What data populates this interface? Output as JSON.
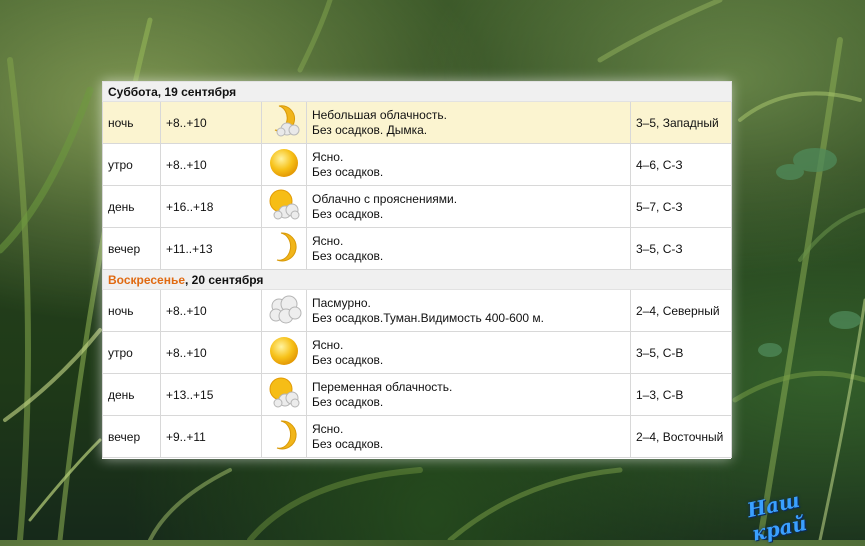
{
  "days": [
    {
      "weekday": "Суббота",
      "date_rest": ", 19 сентября",
      "weekday_color": "#111111",
      "rows": [
        {
          "period": "ночь",
          "temp": "+8..+10",
          "icon": "moon-cloud-icon",
          "line1": "Небольшая облачность.",
          "line2": "Без осадков. Дымка.",
          "wind": "3–5, Западный"
        },
        {
          "period": "утро",
          "temp": "+8..+10",
          "icon": "sun-icon",
          "line1": "Ясно.",
          "line2": "Без осадков.",
          "wind": "4–6, С-З"
        },
        {
          "period": "день",
          "temp": "+16..+18",
          "icon": "sun-cloud-icon",
          "line1": "Облачно с прояснениями.",
          "line2": "Без осадков.",
          "wind": "5–7, С-З"
        },
        {
          "period": "вечер",
          "temp": "+11..+13",
          "icon": "moon-icon",
          "line1": "Ясно.",
          "line2": "Без осадков.",
          "wind": "3–5, С-З"
        }
      ]
    },
    {
      "weekday": "Воскресенье",
      "date_rest": ", 20 сентября",
      "weekday_color": "#e06a12",
      "rows": [
        {
          "period": "ночь",
          "temp": "+8..+10",
          "icon": "cloud-icon",
          "line1": "Пасмурно.",
          "line2": "Без осадков.Туман.Видимость 400-600 м.",
          "wind": "2–4, Северный"
        },
        {
          "period": "утро",
          "temp": "+8..+10",
          "icon": "sun-icon",
          "line1": "Ясно.",
          "line2": "Без осадков.",
          "wind": "3–5, С-В"
        },
        {
          "period": "день",
          "temp": "+13..+15",
          "icon": "sun-cloud-icon",
          "line1": "Переменная облачность.",
          "line2": "Без осадков.",
          "wind": "1–3, С-В"
        },
        {
          "period": "вечер",
          "temp": "+9..+11",
          "icon": "moon-icon",
          "line1": "Ясно.",
          "line2": "Без осадков.",
          "wind": "2–4, Восточный"
        }
      ]
    }
  ],
  "logo": {
    "text": "Наш край"
  }
}
